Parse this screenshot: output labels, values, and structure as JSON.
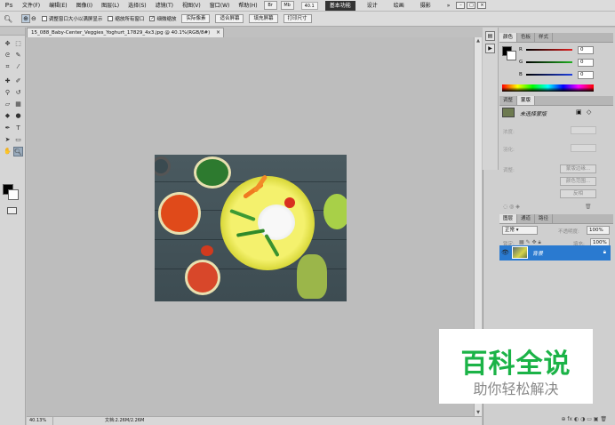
{
  "app": {
    "logo": "Ps"
  },
  "menu": [
    "文件(F)",
    "编辑(E)",
    "图像(I)",
    "图层(L)",
    "选择(S)",
    "滤镜(T)",
    "视图(V)",
    "窗口(W)",
    "帮助(H)"
  ],
  "menubar_tools": {
    "bridge": "Br",
    "mini": "Mb",
    "zoom": "40.1",
    "arrange": "▾"
  },
  "workspaces": [
    "基本功能",
    "设计",
    "绘画",
    "摄影"
  ],
  "workspace_more": "»",
  "options": {
    "resize_windows": "调整窗口大小以满屏显示",
    "zoom_all": "缩放所有窗口",
    "scrubby_zoom": "细微缩放",
    "actual_pixels": "实际像素",
    "fit_screen": "适合屏幕",
    "fill_screen": "填充屏幕",
    "print_size": "打印尺寸"
  },
  "document": {
    "tab_title": "15_088_Baby-Center_Veggies_Yoghurt_17829_4x3.jpg @ 40.1%(RGB/8#)",
    "close": "×"
  },
  "status": {
    "zoom": "40.13%",
    "doc_size": "文档:2.26M/2.26M"
  },
  "color_panel": {
    "tabs": [
      "颜色",
      "色板",
      "样式"
    ],
    "channels": [
      {
        "label": "R",
        "value": "0",
        "color": "#e02020"
      },
      {
        "label": "G",
        "value": "0",
        "color": "#20b020"
      },
      {
        "label": "B",
        "value": "0",
        "color": "#2040e0"
      }
    ]
  },
  "adjust_panel": {
    "tabs": [
      "调整",
      "蒙版"
    ],
    "title": "未选择蒙版",
    "density": "浓度:",
    "feather": "羽化:",
    "refine": "调整:",
    "mask_edge": "蒙版边缘...",
    "color_range": "颜色范围...",
    "invert": "反相"
  },
  "layers_panel": {
    "tabs": [
      "图层",
      "通道",
      "路径"
    ],
    "blend_mode": "正常",
    "opacity_label": "不透明度:",
    "opacity": "100%",
    "lock_label": "锁定:",
    "fill_label": "填充:",
    "fill": "100%",
    "layer_name": "背景",
    "bottom_icons": "⊕ fx ◐ ◑ ▭ ▣ 🗑"
  },
  "watermark": {
    "title": "百科全说",
    "subtitle": "助你轻松解决"
  }
}
